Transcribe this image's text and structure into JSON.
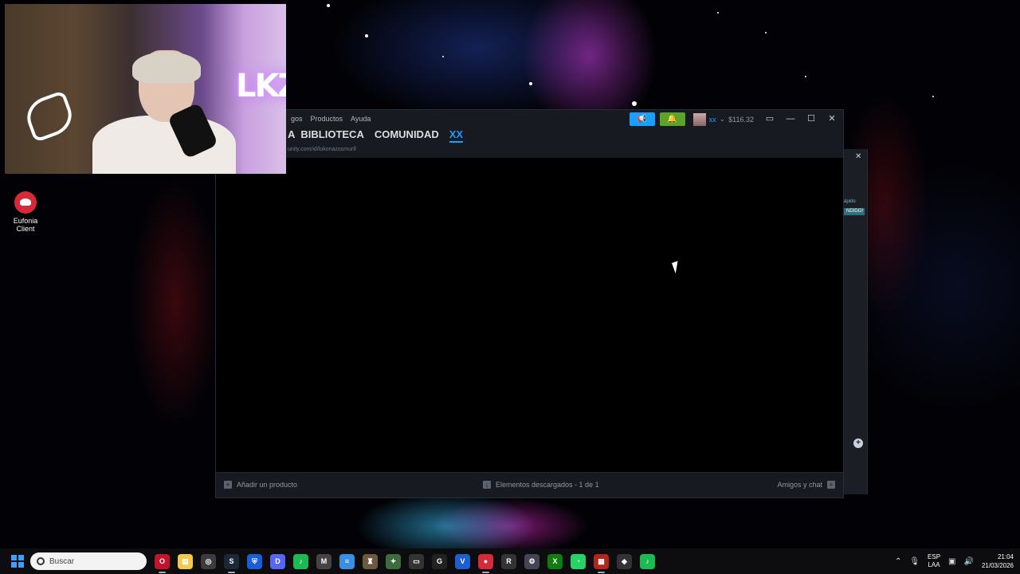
{
  "desktop": {
    "icon_label": "Eufonia Client"
  },
  "webcam": {
    "neon_text": "LKZ"
  },
  "steam": {
    "menu": [
      "gos",
      "Productos",
      "Ayuda"
    ],
    "nav": {
      "partial": "A",
      "library": "BIBLIOTECA",
      "community": "COMUNIDAD",
      "profile": "XX"
    },
    "url": "unity.com/id/lokonazosmurf/",
    "username": "xx",
    "balance": "$116.32",
    "bottom": {
      "add_product": "Añadir un producto",
      "downloads": "Elementos descargados - 1 de 1",
      "friends": "Amigos y chat"
    }
  },
  "back_window": {
    "text1": "ápido",
    "pill": "NDIDO!"
  },
  "taskbar": {
    "search_placeholder": "Buscar",
    "apps": [
      {
        "name": "opera-gx",
        "color": "#c3142b",
        "glyph": "O"
      },
      {
        "name": "file-explorer",
        "color": "#f2c94c",
        "glyph": "▤"
      },
      {
        "name": "chrome",
        "color": "#3b3b3b",
        "glyph": "◎"
      },
      {
        "name": "steam",
        "color": "#1b2838",
        "glyph": "S"
      },
      {
        "name": "bitwarden",
        "color": "#175ddc",
        "glyph": "⛨"
      },
      {
        "name": "discord",
        "color": "#5865f2",
        "glyph": "D"
      },
      {
        "name": "spotify",
        "color": "#1db954",
        "glyph": "♪"
      },
      {
        "name": "gm-app",
        "color": "#444",
        "glyph": "M"
      },
      {
        "name": "notepad",
        "color": "#3a8ee6",
        "glyph": "≡"
      },
      {
        "name": "game-a",
        "color": "#6b5a3e",
        "glyph": "♜"
      },
      {
        "name": "game-b",
        "color": "#3c6b3c",
        "glyph": "✦"
      },
      {
        "name": "racing",
        "color": "#333",
        "glyph": "▭"
      },
      {
        "name": "g-hub",
        "color": "#222",
        "glyph": "G"
      },
      {
        "name": "valorant",
        "color": "#1e5fd0",
        "glyph": "V"
      },
      {
        "name": "eufonia",
        "color": "#d42a3a",
        "glyph": "●"
      },
      {
        "name": "rockstar",
        "color": "#333",
        "glyph": "R"
      },
      {
        "name": "wrench",
        "color": "#445",
        "glyph": "⚙"
      },
      {
        "name": "xbox",
        "color": "#107c10",
        "glyph": "X"
      },
      {
        "name": "whatsapp",
        "color": "#25d366",
        "glyph": "◔"
      },
      {
        "name": "voicemeeter",
        "color": "#b3261e",
        "glyph": "▦"
      },
      {
        "name": "ea",
        "color": "#333",
        "glyph": "◆"
      },
      {
        "name": "spotify-2",
        "color": "#1db954",
        "glyph": "♪"
      }
    ],
    "lang": [
      "ESP",
      "LAA"
    ],
    "time": "21:04",
    "date": "21/03/2026"
  }
}
